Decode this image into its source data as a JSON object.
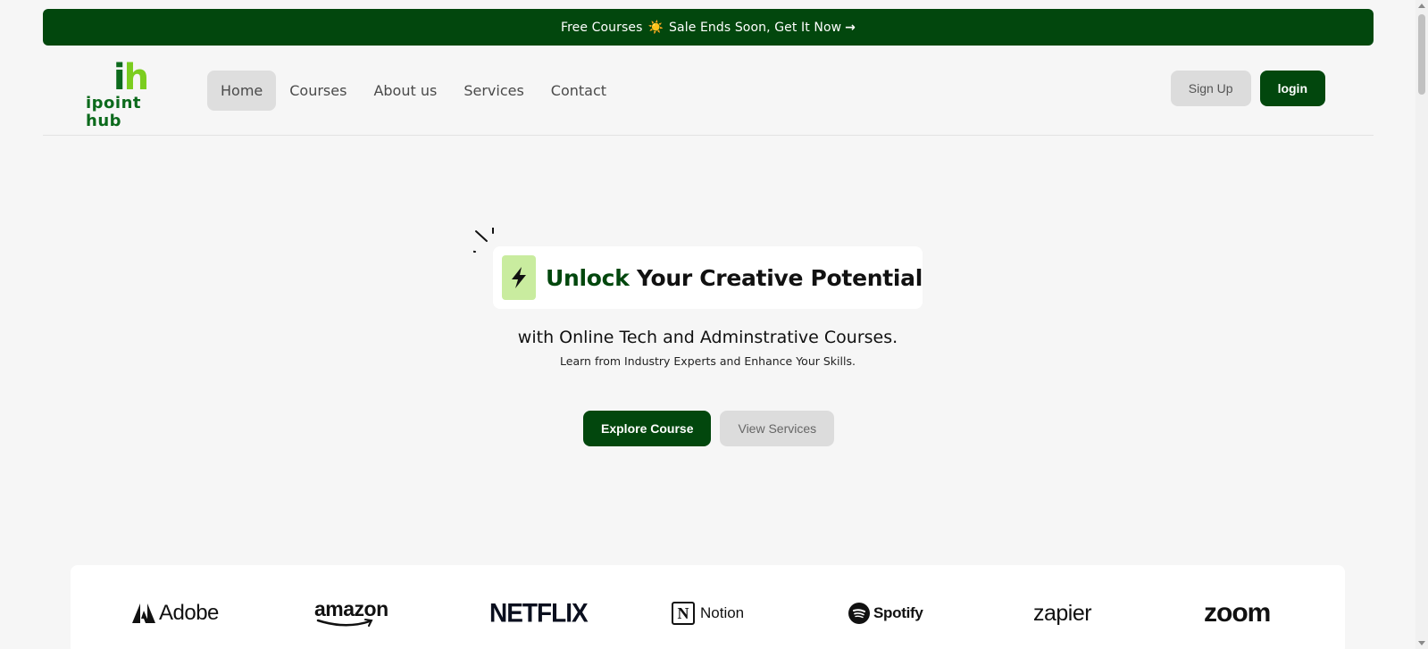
{
  "banner": {
    "text_before": "Free Courses",
    "sun": "☀️",
    "text_after": "Sale Ends Soon, Get It Now",
    "arrow": "→"
  },
  "logo": {
    "mark_i": "i",
    "mark_h": "h",
    "text": "ipoint hub"
  },
  "nav": {
    "items": [
      {
        "label": "Home"
      },
      {
        "label": "Courses"
      },
      {
        "label": "About us"
      },
      {
        "label": "Services"
      },
      {
        "label": "Contact"
      }
    ]
  },
  "auth": {
    "signup_label": "Sign Up",
    "login_label": "login"
  },
  "hero": {
    "title_accent": "Unlock",
    "title_rest": "Your Creative Potential",
    "subtitle": "with Online Tech and Adminstrative Courses.",
    "tagline": "Learn from Industry Experts and Enhance Your Skills.",
    "primary_cta": "Explore Course",
    "secondary_cta": "View Services"
  },
  "brands": {
    "adobe": "Adobe",
    "amazon": "amazon",
    "netflix": "NETFLIX",
    "notion": "Notion",
    "spotify": "Spotify",
    "zapier": "zapier",
    "zoom": "zoom"
  },
  "colors": {
    "brand_green": "#02470d",
    "accent_light_green": "#c9ec9f",
    "logo_h_green": "#7bcd1f"
  }
}
